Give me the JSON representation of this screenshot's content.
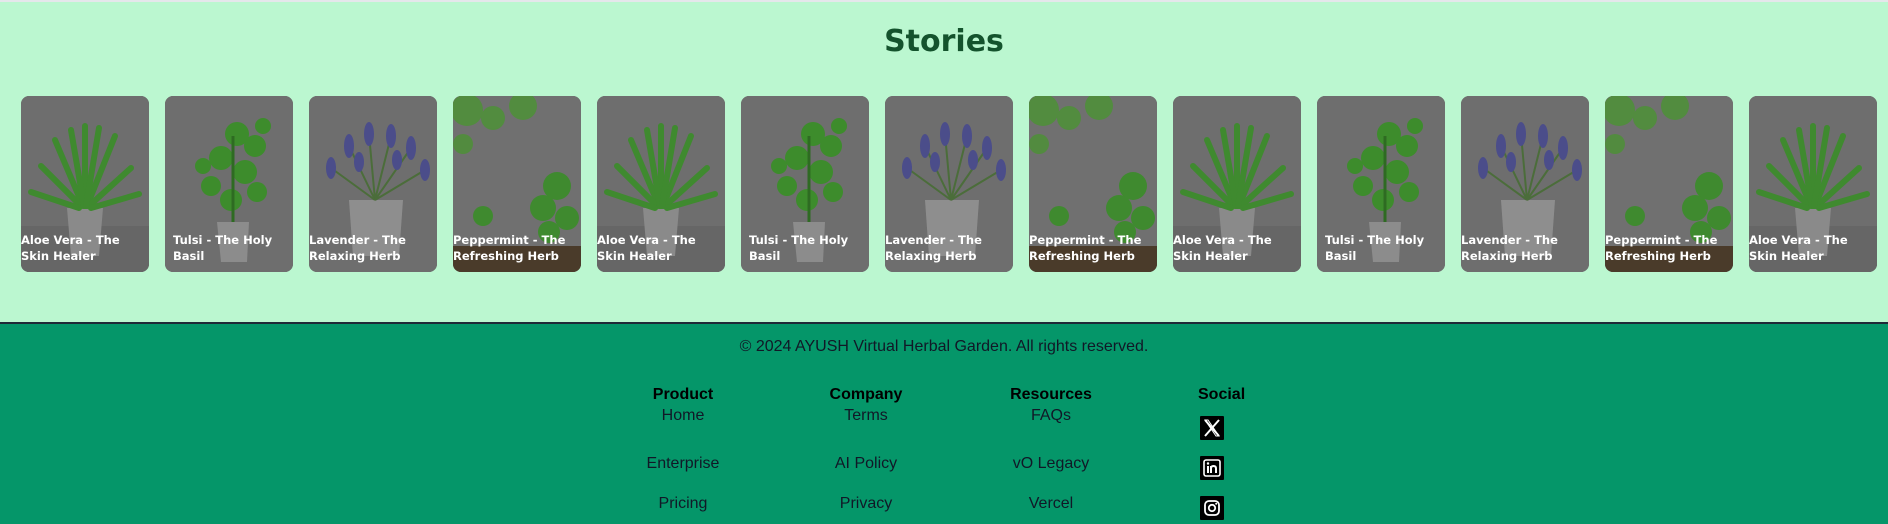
{
  "stories": {
    "title": "Stories",
    "cards": [
      {
        "caption": "Aloe Vera - The Skin Healer",
        "plant": "aloe"
      },
      {
        "caption": "Tulsi - The Holy Basil",
        "plant": "tulsi"
      },
      {
        "caption": "Lavender - The Relaxing Herb",
        "plant": "lavender"
      },
      {
        "caption": "Peppermint - The Refreshing Herb",
        "plant": "peppermint"
      },
      {
        "caption": "Aloe Vera - The Skin Healer",
        "plant": "aloe"
      },
      {
        "caption": "Tulsi - The Holy Basil",
        "plant": "tulsi"
      },
      {
        "caption": "Lavender - The Relaxing Herb",
        "plant": "lavender"
      },
      {
        "caption": "Peppermint - The Refreshing Herb",
        "plant": "peppermint"
      },
      {
        "caption": "Aloe Vera - The Skin Healer",
        "plant": "aloe"
      },
      {
        "caption": "Tulsi - The Holy Basil",
        "plant": "tulsi"
      },
      {
        "caption": "Lavender - The Relaxing Herb",
        "plant": "lavender"
      },
      {
        "caption": "Peppermint - The Refreshing Herb",
        "plant": "peppermint"
      },
      {
        "caption": "Aloe Vera - The Skin Healer",
        "plant": "aloe"
      }
    ]
  },
  "footer": {
    "copyright": "© 2024 AYUSH Virtual Herbal Garden. All rights reserved.",
    "columns": {
      "product": {
        "heading": "Product",
        "links": [
          "Home",
          "Enterprise",
          "Pricing"
        ]
      },
      "company": {
        "heading": "Company",
        "links": [
          "Terms",
          "AI Policy",
          "Privacy"
        ]
      },
      "resources": {
        "heading": "Resources",
        "links": [
          "FAQs",
          "vO Legacy",
          "Vercel"
        ]
      }
    },
    "social": {
      "heading": "Social",
      "icons": [
        "x-icon",
        "linkedin-icon",
        "instagram-icon"
      ]
    }
  },
  "colors": {
    "stories_bg": "#bbf7d0",
    "title": "#14532d",
    "footer_bg": "#059669"
  }
}
